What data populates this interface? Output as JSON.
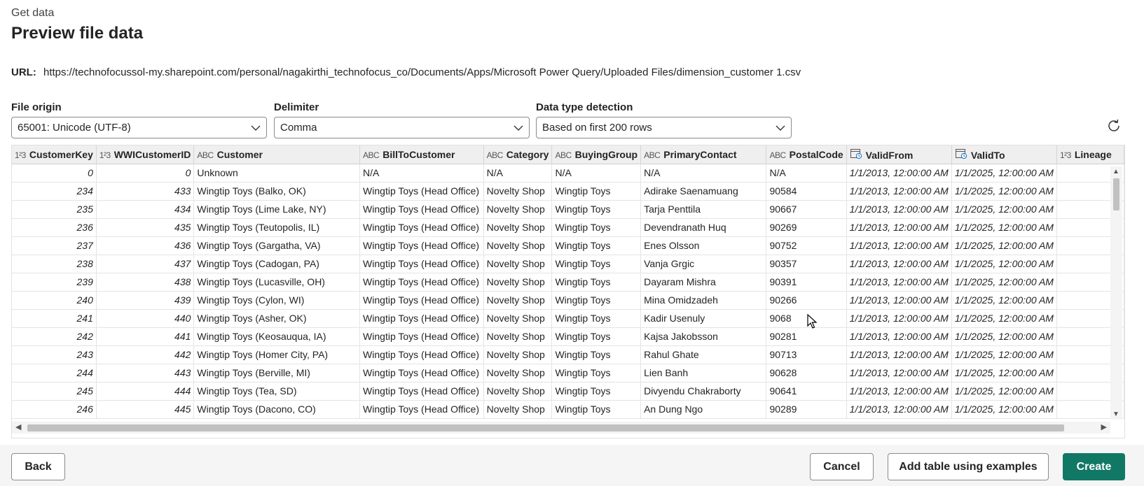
{
  "header": {
    "breadcrumb": "Get data",
    "title": "Preview file data"
  },
  "url": {
    "label": "URL:",
    "value": "https://technofocussol-my.sharepoint.com/personal/nagakirthi_technofocus_co/Documents/Apps/Microsoft Power Query/Uploaded Files/dimension_customer 1.csv"
  },
  "options": {
    "file_origin": {
      "label": "File origin",
      "value": "65001: Unicode (UTF-8)"
    },
    "delimiter": {
      "label": "Delimiter",
      "value": "Comma"
    },
    "detection": {
      "label": "Data type detection",
      "value": "Based on first 200 rows"
    }
  },
  "table": {
    "columns": [
      {
        "name": "CustomerKey",
        "type": "1²3",
        "icon": "number-type-icon"
      },
      {
        "name": "WWICustomerID",
        "type": "1²3",
        "icon": "number-type-icon"
      },
      {
        "name": "Customer",
        "type": "ABC",
        "icon": "text-type-icon"
      },
      {
        "name": "BillToCustomer",
        "type": "ABC",
        "icon": "text-type-icon"
      },
      {
        "name": "Category",
        "type": "ABC",
        "icon": "text-type-icon"
      },
      {
        "name": "BuyingGroup",
        "type": "ABC",
        "icon": "text-type-icon"
      },
      {
        "name": "PrimaryContact",
        "type": "ABC",
        "icon": "text-type-icon"
      },
      {
        "name": "PostalCode",
        "type": "ABC",
        "icon": "text-type-icon"
      },
      {
        "name": "ValidFrom",
        "type": "datetime",
        "icon": "datetime-type-icon"
      },
      {
        "name": "ValidTo",
        "type": "datetime",
        "icon": "datetime-type-icon"
      },
      {
        "name": "Lineage",
        "type": "1²3",
        "icon": "number-type-icon"
      }
    ],
    "rows": [
      [
        "0",
        "0",
        "Unknown",
        "N/A",
        "N/A",
        "N/A",
        "N/A",
        "N/A",
        "1/1/2013, 12:00:00 AM",
        "1/1/2025, 12:00:00 AM",
        ""
      ],
      [
        "234",
        "433",
        "Wingtip Toys (Balko, OK)",
        "Wingtip Toys (Head Office)",
        "Novelty Shop",
        "Wingtip Toys",
        "Adirake Saenamuang",
        "90584",
        "1/1/2013, 12:00:00 AM",
        "1/1/2025, 12:00:00 AM",
        ""
      ],
      [
        "235",
        "434",
        "Wingtip Toys (Lime Lake, NY)",
        "Wingtip Toys (Head Office)",
        "Novelty Shop",
        "Wingtip Toys",
        "Tarja Penttila",
        "90667",
        "1/1/2013, 12:00:00 AM",
        "1/1/2025, 12:00:00 AM",
        ""
      ],
      [
        "236",
        "435",
        "Wingtip Toys (Teutopolis, IL)",
        "Wingtip Toys (Head Office)",
        "Novelty Shop",
        "Wingtip Toys",
        "Devendranath Huq",
        "90269",
        "1/1/2013, 12:00:00 AM",
        "1/1/2025, 12:00:00 AM",
        ""
      ],
      [
        "237",
        "436",
        "Wingtip Toys (Gargatha, VA)",
        "Wingtip Toys (Head Office)",
        "Novelty Shop",
        "Wingtip Toys",
        "Enes Olsson",
        "90752",
        "1/1/2013, 12:00:00 AM",
        "1/1/2025, 12:00:00 AM",
        ""
      ],
      [
        "238",
        "437",
        "Wingtip Toys (Cadogan, PA)",
        "Wingtip Toys (Head Office)",
        "Novelty Shop",
        "Wingtip Toys",
        "Vanja Grgic",
        "90357",
        "1/1/2013, 12:00:00 AM",
        "1/1/2025, 12:00:00 AM",
        ""
      ],
      [
        "239",
        "438",
        "Wingtip Toys (Lucasville, OH)",
        "Wingtip Toys (Head Office)",
        "Novelty Shop",
        "Wingtip Toys",
        "Dayaram Mishra",
        "90391",
        "1/1/2013, 12:00:00 AM",
        "1/1/2025, 12:00:00 AM",
        ""
      ],
      [
        "240",
        "439",
        "Wingtip Toys (Cylon, WI)",
        "Wingtip Toys (Head Office)",
        "Novelty Shop",
        "Wingtip Toys",
        "Mina Omidzadeh",
        "90266",
        "1/1/2013, 12:00:00 AM",
        "1/1/2025, 12:00:00 AM",
        ""
      ],
      [
        "241",
        "440",
        "Wingtip Toys (Asher, OK)",
        "Wingtip Toys (Head Office)",
        "Novelty Shop",
        "Wingtip Toys",
        "Kadir Usenuly",
        "9068",
        "1/1/2013, 12:00:00 AM",
        "1/1/2025, 12:00:00 AM",
        ""
      ],
      [
        "242",
        "441",
        "Wingtip Toys (Keosauqua, IA)",
        "Wingtip Toys (Head Office)",
        "Novelty Shop",
        "Wingtip Toys",
        "Kajsa Jakobsson",
        "90281",
        "1/1/2013, 12:00:00 AM",
        "1/1/2025, 12:00:00 AM",
        ""
      ],
      [
        "243",
        "442",
        "Wingtip Toys (Homer City, PA)",
        "Wingtip Toys (Head Office)",
        "Novelty Shop",
        "Wingtip Toys",
        "Rahul Ghate",
        "90713",
        "1/1/2013, 12:00:00 AM",
        "1/1/2025, 12:00:00 AM",
        ""
      ],
      [
        "244",
        "443",
        "Wingtip Toys (Berville, MI)",
        "Wingtip Toys (Head Office)",
        "Novelty Shop",
        "Wingtip Toys",
        "Lien Banh",
        "90628",
        "1/1/2013, 12:00:00 AM",
        "1/1/2025, 12:00:00 AM",
        ""
      ],
      [
        "245",
        "444",
        "Wingtip Toys (Tea, SD)",
        "Wingtip Toys (Head Office)",
        "Novelty Shop",
        "Wingtip Toys",
        "Divyendu Chakraborty",
        "90641",
        "1/1/2013, 12:00:00 AM",
        "1/1/2025, 12:00:00 AM",
        ""
      ],
      [
        "246",
        "445",
        "Wingtip Toys (Dacono, CO)",
        "Wingtip Toys (Head Office)",
        "Novelty Shop",
        "Wingtip Toys",
        "An Dung Ngo",
        "90289",
        "1/1/2013, 12:00:00 AM",
        "1/1/2025, 12:00:00 AM",
        ""
      ]
    ]
  },
  "buttons": {
    "back": "Back",
    "cancel": "Cancel",
    "add_table": "Add table using examples",
    "create": "Create"
  },
  "colors": {
    "primary": "#117865",
    "header_bg": "#efefef"
  },
  "icons": {
    "refresh": "refresh-icon",
    "dropdown": "chevron-down-icon"
  }
}
